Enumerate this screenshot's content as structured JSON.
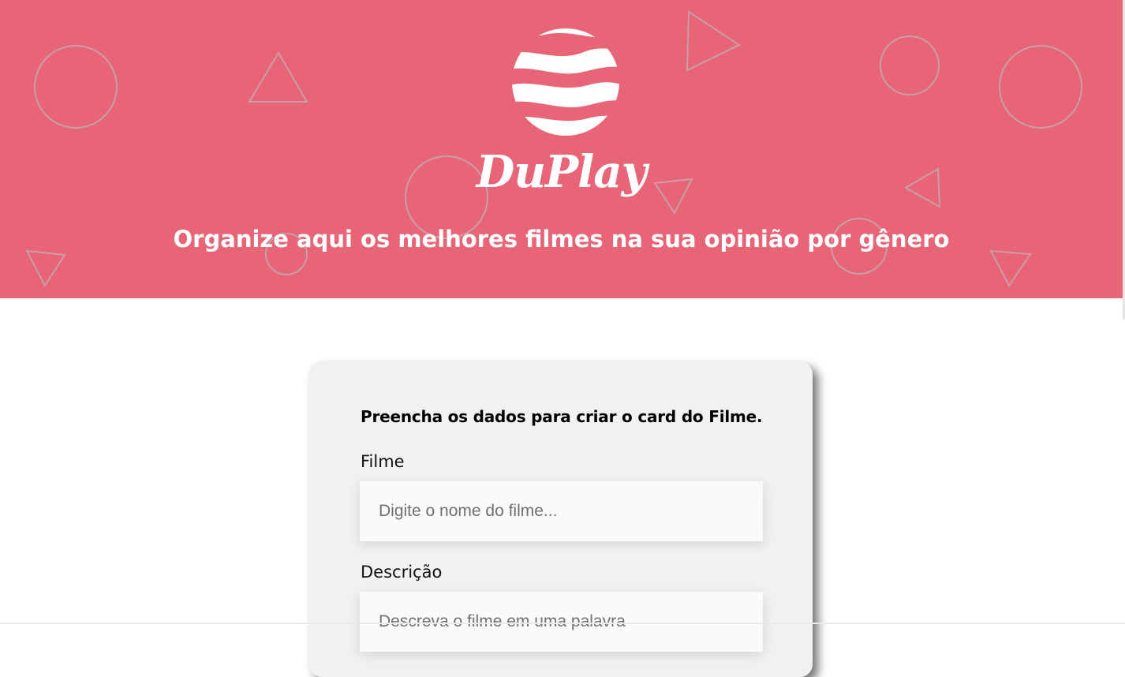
{
  "brand": {
    "name": "DuPlay",
    "logo": "striped-sphere-logo",
    "tagline": "Organize aqui os melhores filmes na sua opinião por gênero"
  },
  "colors": {
    "hero_background": "#e86577",
    "card_background": "#f1f1f1",
    "text_primary": "#000000"
  },
  "form": {
    "title": "Preencha os dados para criar o card do Filme.",
    "fields": [
      {
        "label": "Filme",
        "value": "",
        "placeholder": "Digite o nome do filme..."
      },
      {
        "label": "Descrição",
        "value": "",
        "placeholder": "Descreva o filme em uma palavra"
      }
    ]
  }
}
